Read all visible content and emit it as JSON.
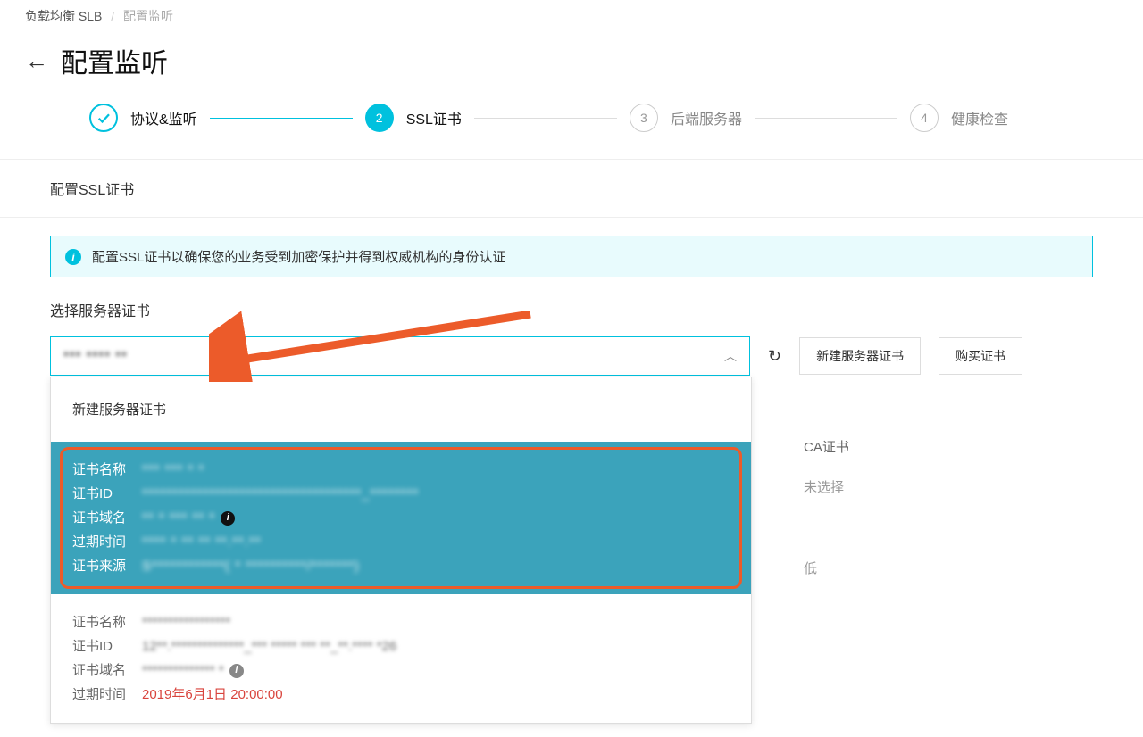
{
  "breadcrumb": {
    "root": "负载均衡 SLB",
    "current": "配置监听"
  },
  "page_title": "配置监听",
  "steps": {
    "s1": "协议&监听",
    "s2_num": "2",
    "s2": "SSL证书",
    "s3_num": "3",
    "s3": "后端服务器",
    "s4_num": "4",
    "s4": "健康检查"
  },
  "panel": {
    "header": "配置SSL证书",
    "alert": "配置SSL证书以确保您的业务受到加密保护并得到权威机构的身份认证",
    "select_label": "选择服务器证书",
    "select_value": "*** **** **",
    "create_cert_btn": "新建服务器证书",
    "buy_cert_btn": "购买证书"
  },
  "dropdown": {
    "new_option": "新建服务器证书",
    "opt_labels": {
      "name": "证书名称",
      "id": "证书ID",
      "domain": "证书域名",
      "expire": "过期时间",
      "source": "证书来源"
    },
    "opt1": {
      "name": "*** *** * *",
      "id": "************************************_********",
      "domain": "** * *** ** *",
      "expire": "**** * ** ** **.**.**",
      "source": "S************( * **********/*******)"
    },
    "opt2": {
      "name": "*****************",
      "id": "12**.**************_*** ***** *** **_**.**** *26",
      "domain": "************** *",
      "expire": "2019年6月1日 20:00:00"
    }
  },
  "right": {
    "ca_label": "CA证书",
    "ca_value": "未选择",
    "low": "低"
  }
}
